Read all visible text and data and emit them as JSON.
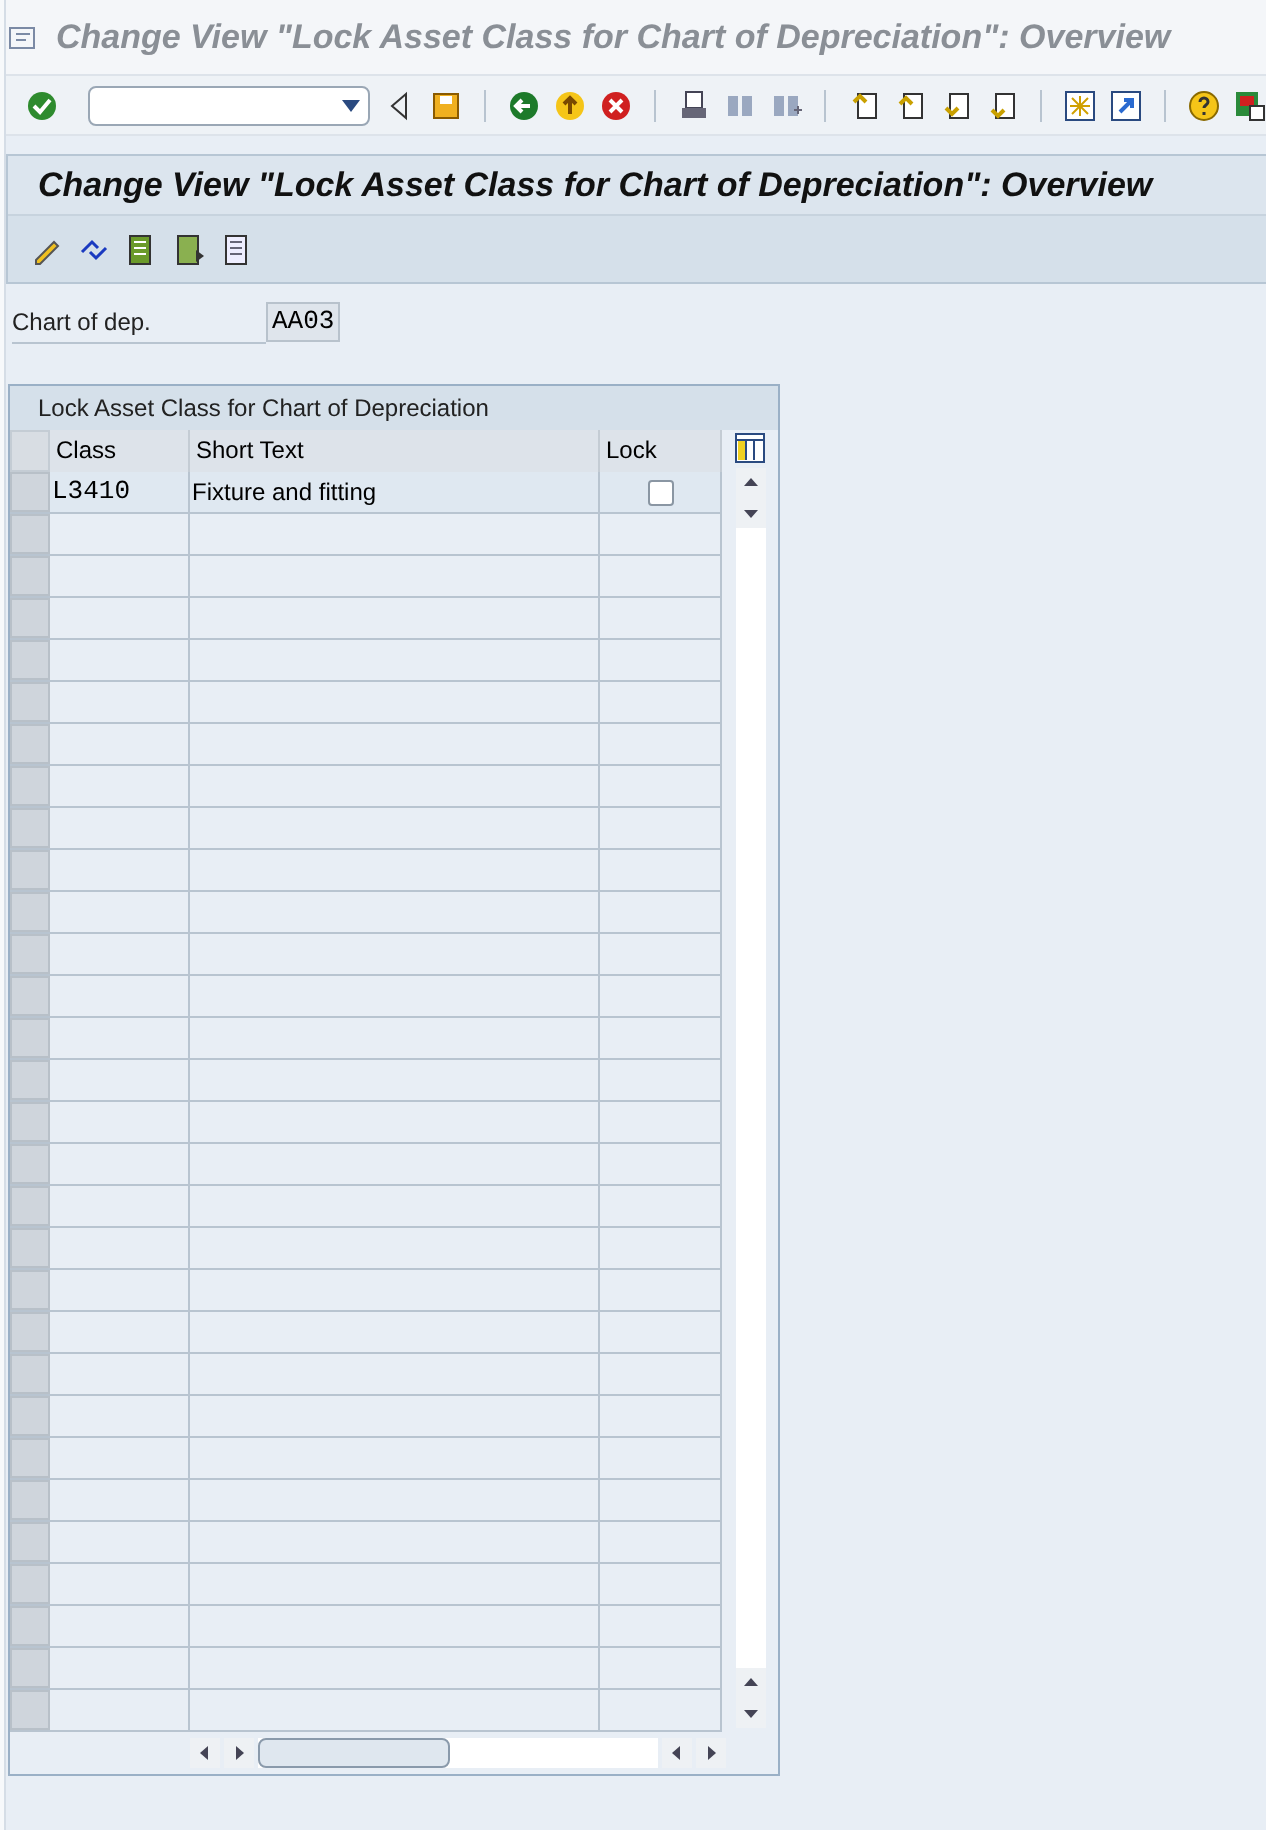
{
  "window": {
    "title": "Change View \"Lock Asset Class for Chart of Depreciation\": Overview"
  },
  "screen_title": "Change View \"Lock Asset Class for Chart of Depreciation\": Overview",
  "fields": [
    {
      "label": "Chart of dep.",
      "value": "AA03"
    }
  ],
  "table": {
    "title": "Lock Asset Class for Chart of Depreciation",
    "columns": [
      "Class",
      "Short Text",
      "Lock"
    ],
    "rows": [
      {
        "class": "L3410",
        "short_text": "Fixture and fitting",
        "lock": false
      }
    ]
  }
}
